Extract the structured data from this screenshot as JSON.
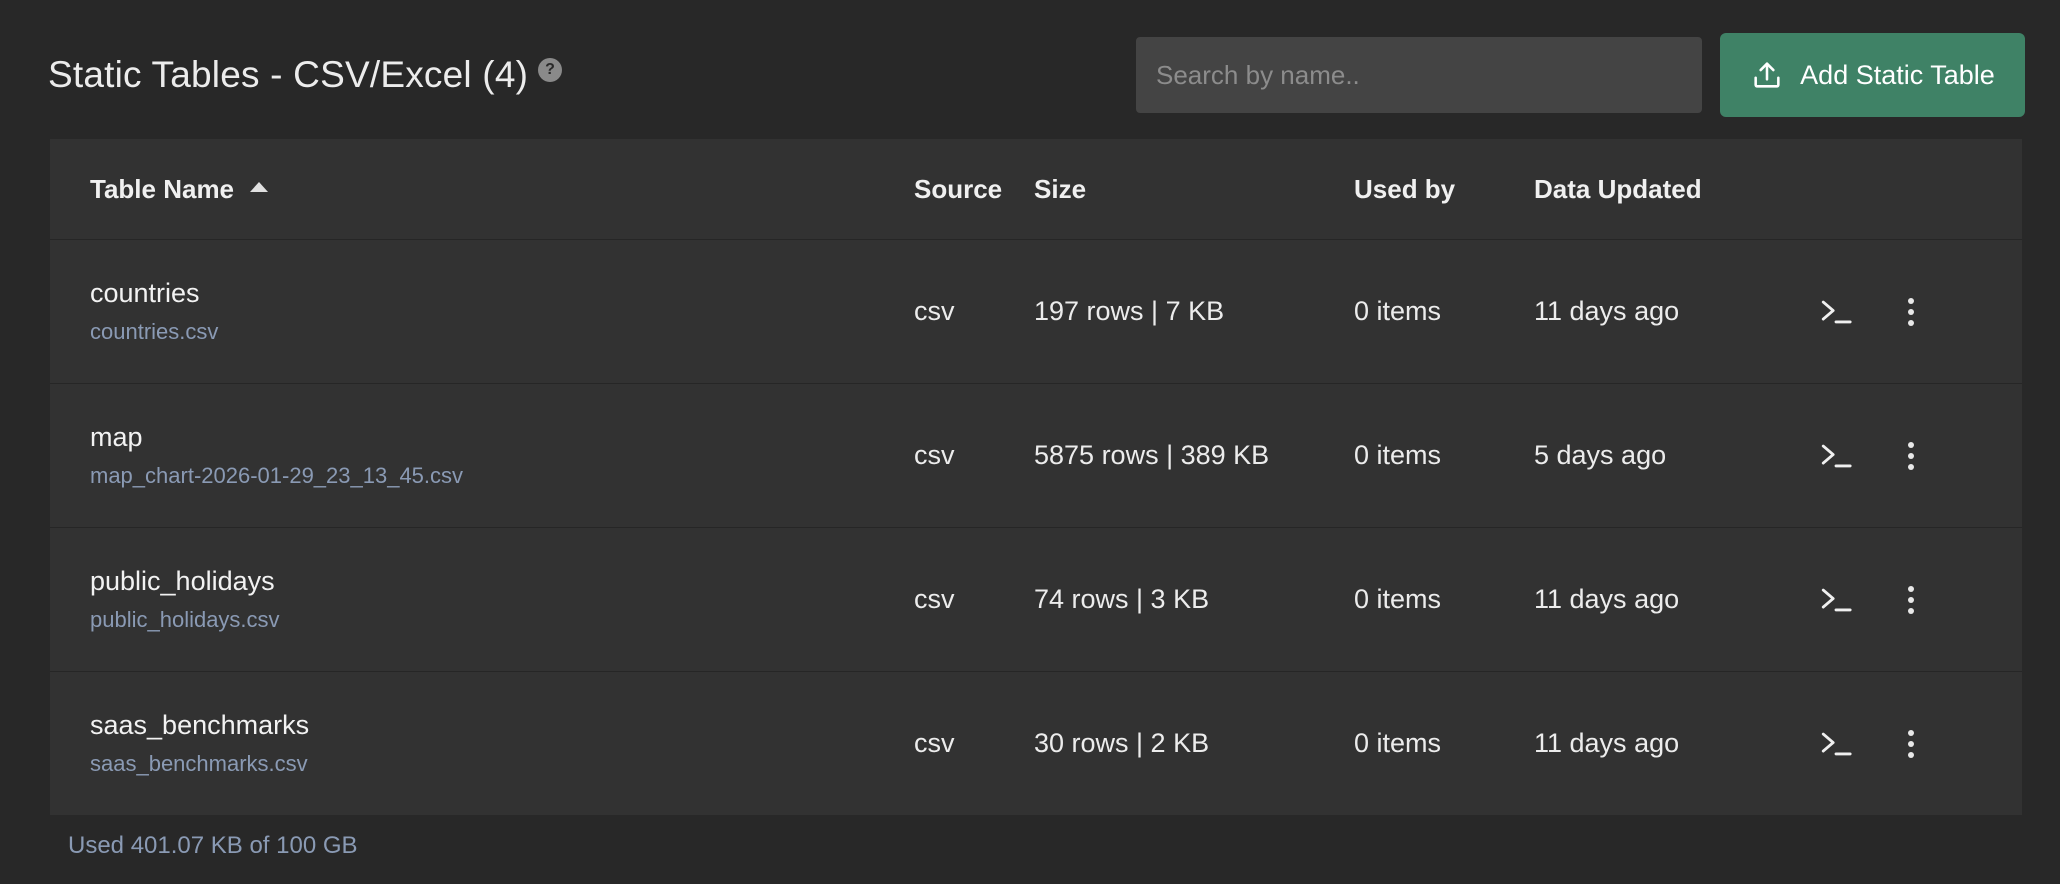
{
  "header": {
    "title": "Static Tables - CSV/Excel (4)",
    "help_icon": "question-icon",
    "search_placeholder": "Search by name..",
    "search_value": "",
    "add_button_label": "Add Static Table",
    "add_button_icon": "upload-icon",
    "accent_color": "#3f8266"
  },
  "table": {
    "columns": [
      "Table Name",
      "Source",
      "Size",
      "Used by",
      "Data Updated"
    ],
    "sort_column": "Table Name",
    "sort_direction": "ascending",
    "rows": [
      {
        "name": "countries",
        "file": "countries.csv",
        "source": "csv",
        "size": "197 rows | 7 KB",
        "used_by": "0 items",
        "updated": "11 days ago"
      },
      {
        "name": "map",
        "file": "map_chart-2026-01-29_23_13_45.csv",
        "source": "csv",
        "size": "5875 rows | 389 KB",
        "used_by": "0 items",
        "updated": "5 days ago"
      },
      {
        "name": "public_holidays",
        "file": "public_holidays.csv",
        "source": "csv",
        "size": "74 rows | 3 KB",
        "used_by": "0 items",
        "updated": "11 days ago"
      },
      {
        "name": "saas_benchmarks",
        "file": "saas_benchmarks.csv",
        "source": "csv",
        "size": "30 rows | 2 KB",
        "used_by": "0 items",
        "updated": "11 days ago"
      }
    ],
    "row_action_icons": [
      "terminal-icon",
      "more-vertical-icon"
    ]
  },
  "footer": {
    "usage_text": "Used 401.07 KB of 100 GB"
  }
}
